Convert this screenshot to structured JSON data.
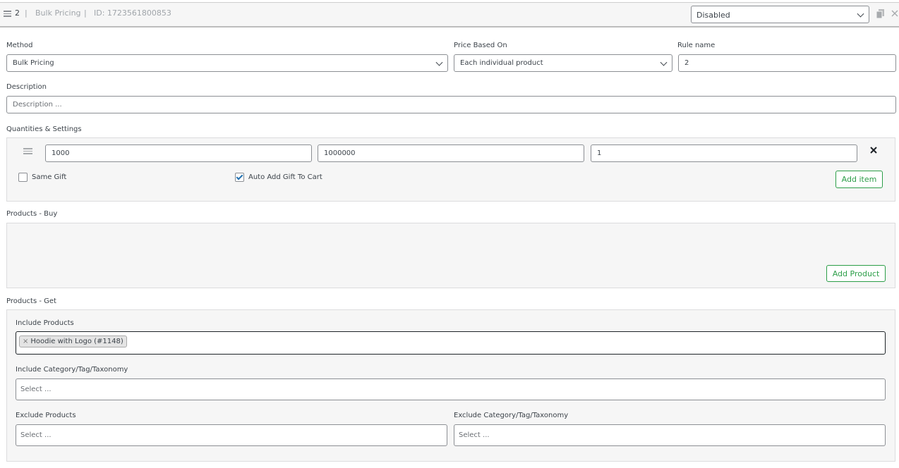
{
  "header": {
    "rule_number": "2",
    "sep1": "|",
    "method_name": "Bulk Pricing",
    "sep2": "|",
    "rule_id": "ID: 1723561800853",
    "status_select": "Disabled"
  },
  "fields": {
    "method_label": "Method",
    "method_value": "Bulk Pricing",
    "price_based_on_label": "Price Based On",
    "price_based_on_value": "Each individual product",
    "rule_name_label": "Rule name",
    "rule_name_value": "2",
    "description_label": "Description",
    "description_placeholder": "Description ..."
  },
  "quantities": {
    "label": "Quantities & Settings",
    "row": {
      "min": "1000",
      "max": "1000000",
      "value": "1"
    },
    "same_gift_label": "Same Gift",
    "same_gift_checked": false,
    "auto_add_label": "Auto Add Gift To Cart",
    "auto_add_checked": true,
    "add_item_button": "Add item"
  },
  "products_buy": {
    "label": "Products - Buy",
    "add_product_button": "Add Product"
  },
  "products_get": {
    "label": "Products - Get",
    "include_products_label": "Include Products",
    "include_products_tags": [
      {
        "remove": "×",
        "text": "Hoodie with Logo (#1148)"
      }
    ],
    "include_category_label": "Include Category/Tag/Taxonomy",
    "include_category_placeholder": "Select ...",
    "exclude_products_label": "Exclude Products",
    "exclude_products_placeholder": "Select ...",
    "exclude_category_label": "Exclude Category/Tag/Taxonomy",
    "exclude_category_placeholder": "Select ..."
  },
  "colors": {
    "accent_green": "#2c9e48",
    "checkbox_blue": "#2271b1"
  },
  "icons": [
    "drag-handle-icon",
    "chevron-down-icon",
    "copy-icon",
    "close-icon",
    "remove-row-icon",
    "checkmark-icon"
  ]
}
